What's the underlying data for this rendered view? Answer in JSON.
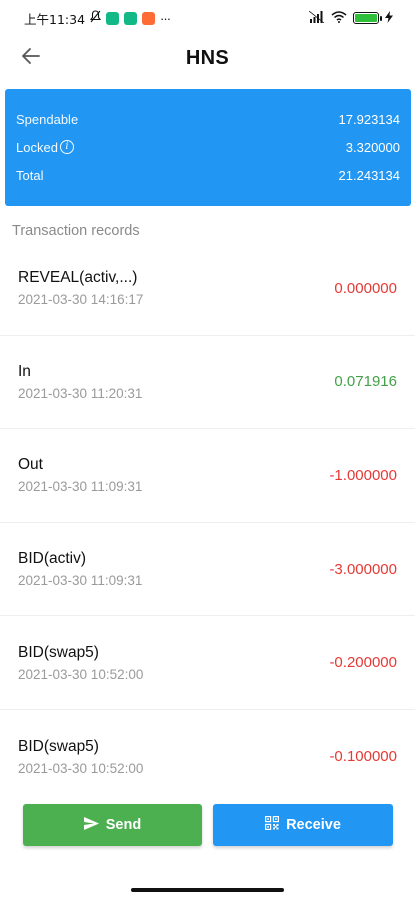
{
  "status_bar": {
    "time": "上午11:34",
    "app_badges": [
      "#12b886",
      "#12b886",
      "#ff6b35"
    ],
    "more": "···",
    "battery_level": 1.0,
    "battery_color": "#2fbf3a"
  },
  "header": {
    "back_icon": "arrow-left-icon",
    "title": "HNS"
  },
  "balance": {
    "spendable_label": "Spendable",
    "spendable_value": "17.923134",
    "locked_label": "Locked",
    "locked_value": "3.320000",
    "total_label": "Total",
    "total_value": "21.243134",
    "card_color": "#2196f3"
  },
  "transactions": {
    "section_title": "Transaction records",
    "items": [
      {
        "type": "REVEAL(activ,...)",
        "time": "2021-03-30 14:16:17",
        "amount": "0.000000",
        "color": "#e53935"
      },
      {
        "type": "In",
        "time": "2021-03-30 11:20:31",
        "amount": "0.071916",
        "color": "#43a047"
      },
      {
        "type": "Out",
        "time": "2021-03-30 11:09:31",
        "amount": "-1.000000",
        "color": "#e53935"
      },
      {
        "type": "BID(activ)",
        "time": "2021-03-30 11:09:31",
        "amount": "-3.000000",
        "color": "#e53935"
      },
      {
        "type": "BID(swap5)",
        "time": "2021-03-30 10:52:00",
        "amount": "-0.200000",
        "color": "#e53935"
      },
      {
        "type": "BID(swap5)",
        "time": "2021-03-30 10:52:00",
        "amount": "-0.100000",
        "color": "#e53935"
      }
    ]
  },
  "actions": {
    "send_label": "Send",
    "send_icon": "send-icon",
    "send_color": "#4caf50",
    "receive_label": "Receive",
    "receive_icon": "qr-code-icon",
    "receive_color": "#2196f3"
  }
}
